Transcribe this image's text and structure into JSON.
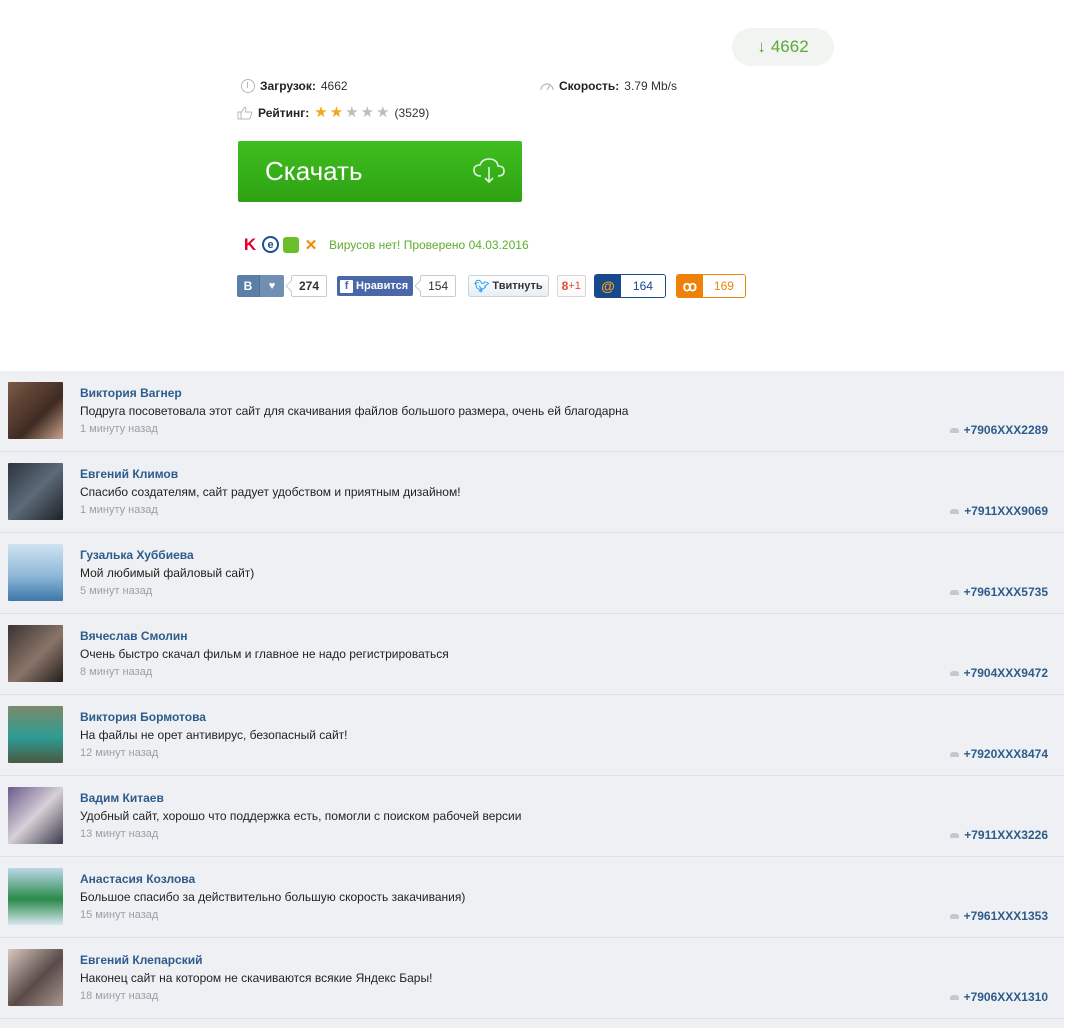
{
  "download_pill": {
    "count": "4662"
  },
  "stats": {
    "downloads_label": "Загрузок:",
    "downloads_value": "4662",
    "speed_label": "Скорость:",
    "speed_value": "3.79 Mb/s",
    "rating_label": "Рейтинг:",
    "rating_stars": 2,
    "rating_max": 5,
    "rating_count": "(3529)"
  },
  "download_button": {
    "label": "Скачать"
  },
  "antivirus": {
    "icons": [
      "kaspersky-icon",
      "eset-icon",
      "cube-antivirus-icon",
      "avast-icon"
    ],
    "text": "Вирусов нет! Проверено 04.03.2016"
  },
  "social": {
    "vk_label": "В",
    "vk_count": "274",
    "fb_label": "Нравится",
    "fb_count": "154",
    "tw_label": "Твитнуть",
    "gplus_label": "+1",
    "mail_count": "164",
    "ok_count": "169"
  },
  "colors": {
    "accent_green": "#37b31a",
    "link_blue": "#2d5c8c",
    "comments_bg": "#eef0f3"
  },
  "comments": [
    {
      "name": "Виктория Вагнер",
      "text": "Подруга посоветовала этот сайт для скачивания файлов большого размера, очень ей благодарна",
      "time": "1 минуту назад",
      "phone": "+7906XXX2289"
    },
    {
      "name": "Евгений Климов",
      "text": "Спасибо создателям, сайт радует удобством и приятным дизайном!",
      "time": "1 минуту назад",
      "phone": "+7911XXX9069"
    },
    {
      "name": "Гузалька Хуббиева",
      "text": "Мой любимый файловый сайт)",
      "time": "5 минут назад",
      "phone": "+7961XXX5735"
    },
    {
      "name": "Вячеслав Смолин",
      "text": "Очень быстро скачал фильм и главное не надо регистрироваться",
      "time": "8 минут назад",
      "phone": "+7904XXX9472"
    },
    {
      "name": "Виктория Бормотова",
      "text": "На файлы не орет антивирус, безопасный сайт!",
      "time": "12 минут назад",
      "phone": "+7920XXX8474"
    },
    {
      "name": "Вадим Китаев",
      "text": "Удобный сайт, хорошо что поддержка есть, помогли с поиском рабочей версии",
      "time": "13 минут назад",
      "phone": "+7911XXX3226"
    },
    {
      "name": "Анастасия Козлова",
      "text": "Большое спасибо за действительно большую скорость закачивания)",
      "time": "15 минут назад",
      "phone": "+7961XXX1353"
    },
    {
      "name": "Евгений Клепарский",
      "text": "Наконец сайт на котором не скачиваются всякие Яндекс Бары!",
      "time": "18 минут назад",
      "phone": "+7906XXX1310"
    }
  ]
}
